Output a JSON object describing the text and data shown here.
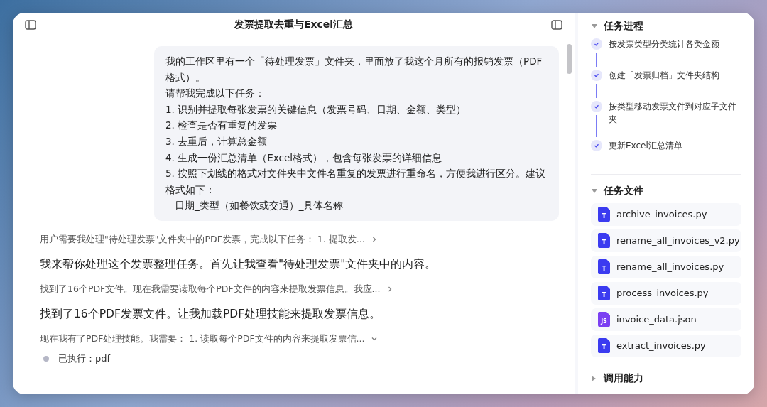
{
  "window": {
    "title": "发票提取去重与Excel汇总"
  },
  "user_message": {
    "lines": [
      "我的工作区里有一个「待处理发票」文件夹，里面放了我这个月所有的报销发票（PDF格式）。",
      "请帮我完成以下任务：",
      "1. 识别并提取每张发票的关键信息（发票号码、日期、金额、类型）",
      "2. 检查是否有重复的发票",
      "3. 去重后，计算总金额",
      "4. 生成一份汇总清单（Excel格式），包含每张发票的详细信息",
      "5. 按照下划线的格式对文件夹中文件名重复的发票进行重命名，方便我进行区分。建议格式如下：",
      "   日期_类型（如餐饮或交通）_具体名称"
    ]
  },
  "conversation": [
    {
      "kind": "thinking",
      "text": "用户需要我处理\"待处理发票\"文件夹中的PDF发票，完成以下任务： 1. 提取发...",
      "expanded": false
    },
    {
      "kind": "reply",
      "text": "我来帮你处理这个发票整理任务。首先让我查看\"待处理发票\"文件夹中的内容。"
    },
    {
      "kind": "thinking",
      "text": "找到了16个PDF文件。现在我需要读取每个PDF文件的内容来提取发票信息。我应...",
      "expanded": false
    },
    {
      "kind": "reply",
      "text": "找到了16个PDF发票文件。让我加载PDF处理技能来提取发票信息。"
    },
    {
      "kind": "thinking",
      "text": "现在我有了PDF处理技能。我需要： 1. 读取每个PDF文件的内容来提取发票信...",
      "expanded": true
    },
    {
      "kind": "step",
      "text": "已执行：pdf"
    }
  ],
  "sidebar": {
    "progress": {
      "title": "任务进程",
      "expanded": true,
      "items": [
        {
          "text": "按发票类型分类统计各类金额",
          "done": true
        },
        {
          "text": "创建「发票归档」文件夹结构",
          "done": true
        },
        {
          "text": "按类型移动发票文件到对应子文件夹",
          "done": true
        },
        {
          "text": "更新Excel汇总清单",
          "done": true
        }
      ]
    },
    "files": {
      "title": "任务文件",
      "expanded": true,
      "items": [
        {
          "name": "archive_invoices.py",
          "kind": "text",
          "icon_label": "T"
        },
        {
          "name": "rename_all_invoices_v2.py",
          "kind": "text",
          "icon_label": "T"
        },
        {
          "name": "rename_all_invoices.py",
          "kind": "text",
          "icon_label": "T"
        },
        {
          "name": "process_invoices.py",
          "kind": "text",
          "icon_label": "T"
        },
        {
          "name": "invoice_data.json",
          "kind": "js",
          "icon_label": "JS"
        },
        {
          "name": "extract_invoices.py",
          "kind": "text",
          "icon_label": "T"
        }
      ]
    },
    "abilities": {
      "title": "调用能力",
      "expanded": false
    }
  }
}
